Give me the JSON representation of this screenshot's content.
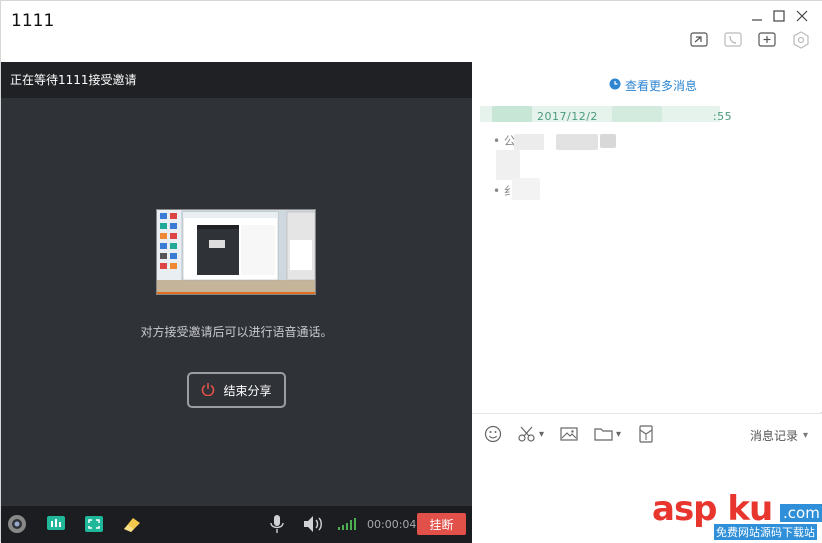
{
  "window": {
    "title": "1111",
    "controls": {
      "minimize_icon": "minimize-icon",
      "maximize_icon": "maximize-icon",
      "close_icon": "close-icon"
    },
    "toolbar_icons": [
      "screen-share-icon",
      "phone-icon",
      "add-chat-icon",
      "settings-hex-icon"
    ]
  },
  "share": {
    "status_text": "正在等待1111接受邀请",
    "hint": "对方接受邀请后可以进行语音通话。",
    "end_button_label": "结束分享",
    "accent": "#e2504a"
  },
  "bottombar": {
    "timer": "00:00:04",
    "hangup_label": "挂断"
  },
  "chat": {
    "more_messages": "查看更多消息",
    "date_partial": "2017/12/2",
    "date_suffix": ":55",
    "bullet1_char": "公",
    "bullet2_char": "纟"
  },
  "composer": {
    "history_label": "消息记录"
  },
  "watermark": {
    "main": "asp ku",
    "com": ".com",
    "sub": "免费网站源码下载站"
  }
}
